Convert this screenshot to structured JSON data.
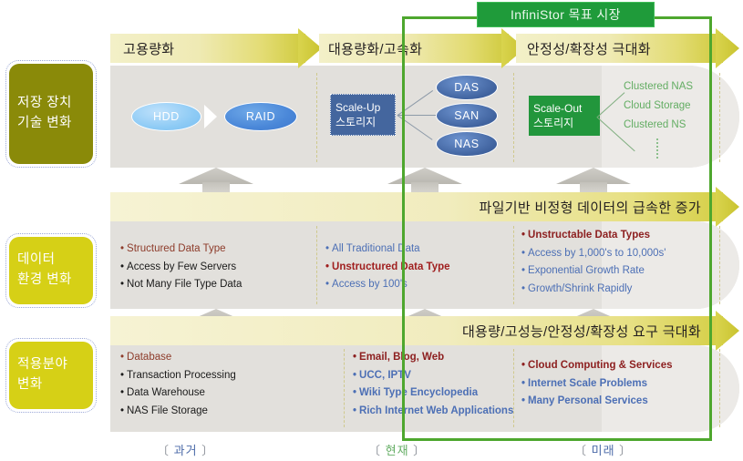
{
  "highlight": {
    "badge_label": "InfiniStor 목표 시장",
    "border_color": "#4ea72e",
    "badge_color": "#1f9b3a"
  },
  "sidebar": {
    "items": [
      {
        "name": "storage-tech-change",
        "label": "저장 장치\n기술 변화",
        "line1": "저장 장치",
        "line2": "기술 변화",
        "color": "#8a8a09"
      },
      {
        "name": "data-env-change",
        "label": "데이터\n환경 변화",
        "line1": "데이터",
        "line2": "환경 변화",
        "color": "#d6d016"
      },
      {
        "name": "application-change",
        "label": "적용분야\n변화",
        "line1": "적용분야",
        "line2": "변화",
        "color": "#d6d016"
      }
    ]
  },
  "rows": {
    "storage": {
      "banners": [
        {
          "label": "고용량화"
        },
        {
          "label": "대용량화/고속화"
        },
        {
          "label": "안정성/확장성 극대화"
        }
      ],
      "past": {
        "hdd": "HDD",
        "raid": "RAID"
      },
      "present": {
        "scale_up_line1": "Scale-Up",
        "scale_up_line2": "스토리지",
        "nodes": [
          "DAS",
          "SAN",
          "NAS"
        ]
      },
      "future": {
        "scale_out_line1": "Scale-Out",
        "scale_out_line2": "스토리지",
        "items": [
          "Clustered NAS",
          "Cloud Storage",
          "Clustered NS"
        ]
      }
    },
    "data": {
      "banner": "파일기반 비정형 데이터의 급속한 증가",
      "columns": [
        {
          "name": "past",
          "items": [
            {
              "text": "Structured Data Type",
              "color": "#8d3b2a",
              "bold": false
            },
            {
              "text": "Access by Few Servers",
              "color": "#1a1a1a",
              "bold": false
            },
            {
              "text": "Not Many File Type Data",
              "color": "#1a1a1a",
              "bold": false
            }
          ]
        },
        {
          "name": "present",
          "items": [
            {
              "text": "All Traditional Data",
              "color": "#4c6fb5",
              "bold": false
            },
            {
              "text": "Unstructured Data Type",
              "color": "#a01f1f",
              "bold": true
            },
            {
              "text": "Access by 100's",
              "color": "#4c6fb5",
              "bold": false
            }
          ]
        },
        {
          "name": "future",
          "items": [
            {
              "text": "Unstructable Data Types",
              "color": "#8d2020",
              "bold": true
            },
            {
              "text": "Access by 1,000's to 10,000s'",
              "color": "#4c6fb5",
              "bold": false
            },
            {
              "text": "Exponential Growth Rate",
              "color": "#4c6fb5",
              "bold": false
            },
            {
              "text": "Growth/Shrink Rapidly",
              "color": "#4c6fb5",
              "bold": false
            }
          ]
        }
      ]
    },
    "apply": {
      "banner": "대용량/고성능/안정성/확장성 요구 극대화",
      "columns": [
        {
          "name": "past",
          "items": [
            {
              "text": "Database",
              "color": "#8d3b2a",
              "bold": false
            },
            {
              "text": "Transaction Processing",
              "color": "#1a1a1a",
              "bold": false
            },
            {
              "text": "Data Warehouse",
              "color": "#1a1a1a",
              "bold": false
            },
            {
              "text": "NAS File Storage",
              "color": "#1a1a1a",
              "bold": false
            }
          ]
        },
        {
          "name": "present",
          "items": [
            {
              "text": "Email, Blog, Web",
              "color": "#8d2020",
              "bold": true
            },
            {
              "text": "UCC, IPTV",
              "color": "#4c6fb5",
              "bold": true
            },
            {
              "text": "Wiki Type Encyclopedia",
              "color": "#4c6fb5",
              "bold": true
            },
            {
              "text": "Rich Internet Web Applications",
              "color": "#4c6fb5",
              "bold": true
            }
          ]
        },
        {
          "name": "future",
          "items": [
            {
              "text": "Cloud Computing & Services",
              "color": "#8d2020",
              "bold": true
            },
            {
              "text": "Internet Scale Problems",
              "color": "#4c6fb5",
              "bold": true
            },
            {
              "text": "Many Personal Services",
              "color": "#4c6fb5",
              "bold": true
            }
          ]
        }
      ]
    }
  },
  "timeline": [
    {
      "open": "〔",
      "label": "과거",
      "close": "〕",
      "color": "#4b6aa8"
    },
    {
      "open": "〔",
      "label": "현재",
      "close": "〕",
      "color": "#63ad63"
    },
    {
      "open": "〔",
      "label": "미래",
      "close": "〕",
      "color": "#4b6aa8"
    }
  ]
}
